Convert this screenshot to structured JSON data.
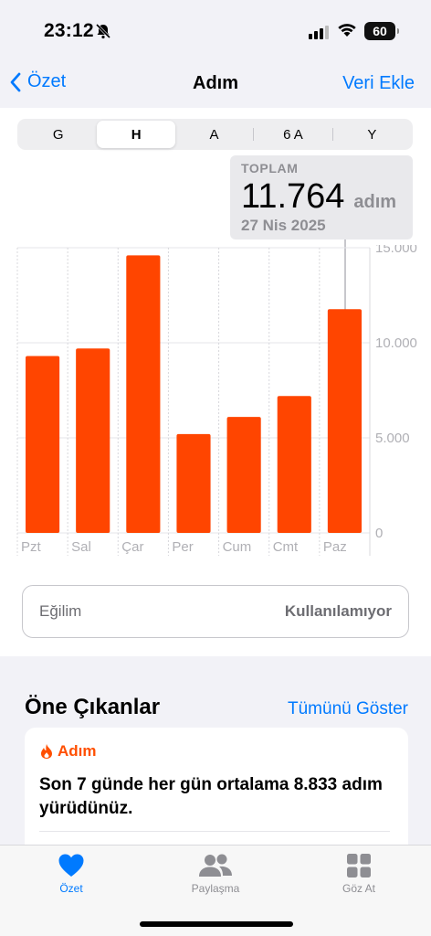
{
  "status": {
    "time": "23:12",
    "battery": "60"
  },
  "nav": {
    "back_label": "Özet",
    "title": "Adım",
    "action_label": "Veri Ekle"
  },
  "segments": [
    "G",
    "H",
    "A",
    "6 A",
    "Y"
  ],
  "tooltip": {
    "label": "TOPLAM",
    "value": "11.764",
    "unit": "adım",
    "date": "27 Nis 2025"
  },
  "chart_data": {
    "type": "bar",
    "categories": [
      "Pzt",
      "Sal",
      "Çar",
      "Per",
      "Cum",
      "Cmt",
      "Paz"
    ],
    "values": [
      9300,
      9700,
      14600,
      5200,
      6100,
      7200,
      11764
    ],
    "ylim": [
      0,
      15000
    ],
    "y_ticks": [
      "15.000",
      "10.000",
      "5.000",
      "0"
    ],
    "y_tick_values": [
      15000,
      10000,
      5000,
      0
    ],
    "bar_color": "#ff4500",
    "selected_index": 6,
    "grid": true
  },
  "trend": {
    "label": "Eğilim",
    "value": "Kullanılamıyor"
  },
  "highlights": {
    "title": "Öne Çıkanlar",
    "link": "Tümünü Göster",
    "card": {
      "tag": "Adım",
      "text": "Son 7 günde her gün ortalama 8.833 adım yürüdünüz."
    }
  },
  "tabs": [
    {
      "label": "Özet",
      "icon": "heart-icon",
      "active": true
    },
    {
      "label": "Paylaşma",
      "icon": "people-icon",
      "active": false
    },
    {
      "label": "Göz At",
      "icon": "grid-icon",
      "active": false
    }
  ],
  "colors": {
    "accent": "#007aff",
    "bar": "#ff4500",
    "flame": "#ff4f00"
  }
}
